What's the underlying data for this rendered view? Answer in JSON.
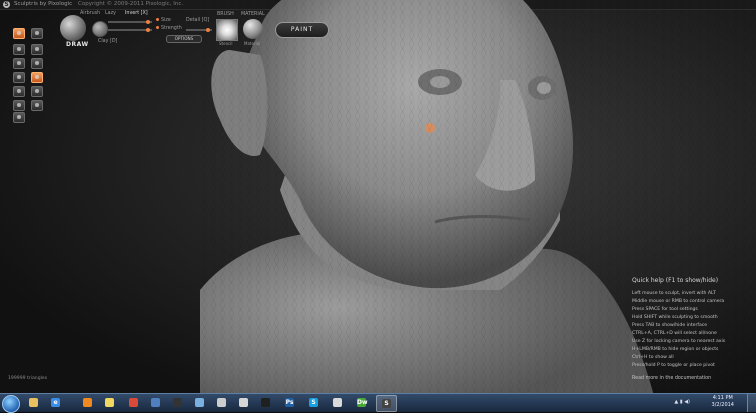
{
  "window": {
    "title": "Sculptris by Pixologic",
    "copyright": "Copyright © 2009-2011 Pixologic, Inc."
  },
  "toolbar": {
    "draw_label": "DRAW",
    "airbrush": "Airbrush",
    "lazy": "Lazy",
    "invert": "Invert [X]",
    "size": "Size",
    "strength": "Strength",
    "detail": "Detail [Q]",
    "clay": "Clay [D]",
    "options": "OPTIONS",
    "brush_label": "BRUSH",
    "brush_sub": "Stencil",
    "material_label": "MATERIAL",
    "material_sub": "Material",
    "paint": "PAINT"
  },
  "stats": {
    "triangles": "199999 triangles"
  },
  "quick_help": {
    "title": "Quick help (F1 to show/hide)",
    "lines": [
      "Left mouse to sculpt, invert with ALT",
      "Middle mouse or RMB to control camera",
      "Press SPACE for tool settings",
      "Hold SHIFT while sculpting to smooth",
      "Press TAB to show/hide interface",
      "CTRL+A, CTRL+D will select all/none",
      "Use Z for locking camera to nearest axis",
      "H+LMB/RMB to hide region or objects",
      "Ctrl+H to show all",
      "Press/hold P to toggle or place pivot"
    ],
    "more": "Read more in the documentation"
  },
  "taskbar": {
    "time": "4:11 PM",
    "date": "3/2/2014",
    "apps": [
      {
        "name": "explorer",
        "glyph": "",
        "color": "#e8c060"
      },
      {
        "name": "internet-explorer",
        "glyph": "e",
        "color": "#3a8ee6"
      },
      {
        "name": "media-player",
        "glyph": "",
        "color": "#f08a20"
      },
      {
        "name": "sticky-notes",
        "glyph": "",
        "color": "#f0d860"
      },
      {
        "name": "chrome",
        "glyph": "",
        "color": "#d94a38"
      },
      {
        "name": "app-viewer",
        "glyph": "",
        "color": "#5080c0"
      },
      {
        "name": "game",
        "glyph": "",
        "color": "#333333"
      },
      {
        "name": "utility",
        "glyph": "",
        "color": "#7ab0e0"
      },
      {
        "name": "camera",
        "glyph": "",
        "color": "#cccccc"
      },
      {
        "name": "tool",
        "glyph": "",
        "color": "#d6d6d6"
      },
      {
        "name": "terminal",
        "glyph": "",
        "color": "#202020"
      },
      {
        "name": "photoshop",
        "glyph": "Ps",
        "color": "#1f5fa8"
      },
      {
        "name": "skype",
        "glyph": "S",
        "color": "#18a0e0"
      },
      {
        "name": "notepad",
        "glyph": "",
        "color": "#d9d9d9"
      },
      {
        "name": "dreamweaver",
        "glyph": "Dw",
        "color": "#4aa838"
      },
      {
        "name": "sculptris",
        "glyph": "S",
        "color": "#444444"
      }
    ]
  }
}
